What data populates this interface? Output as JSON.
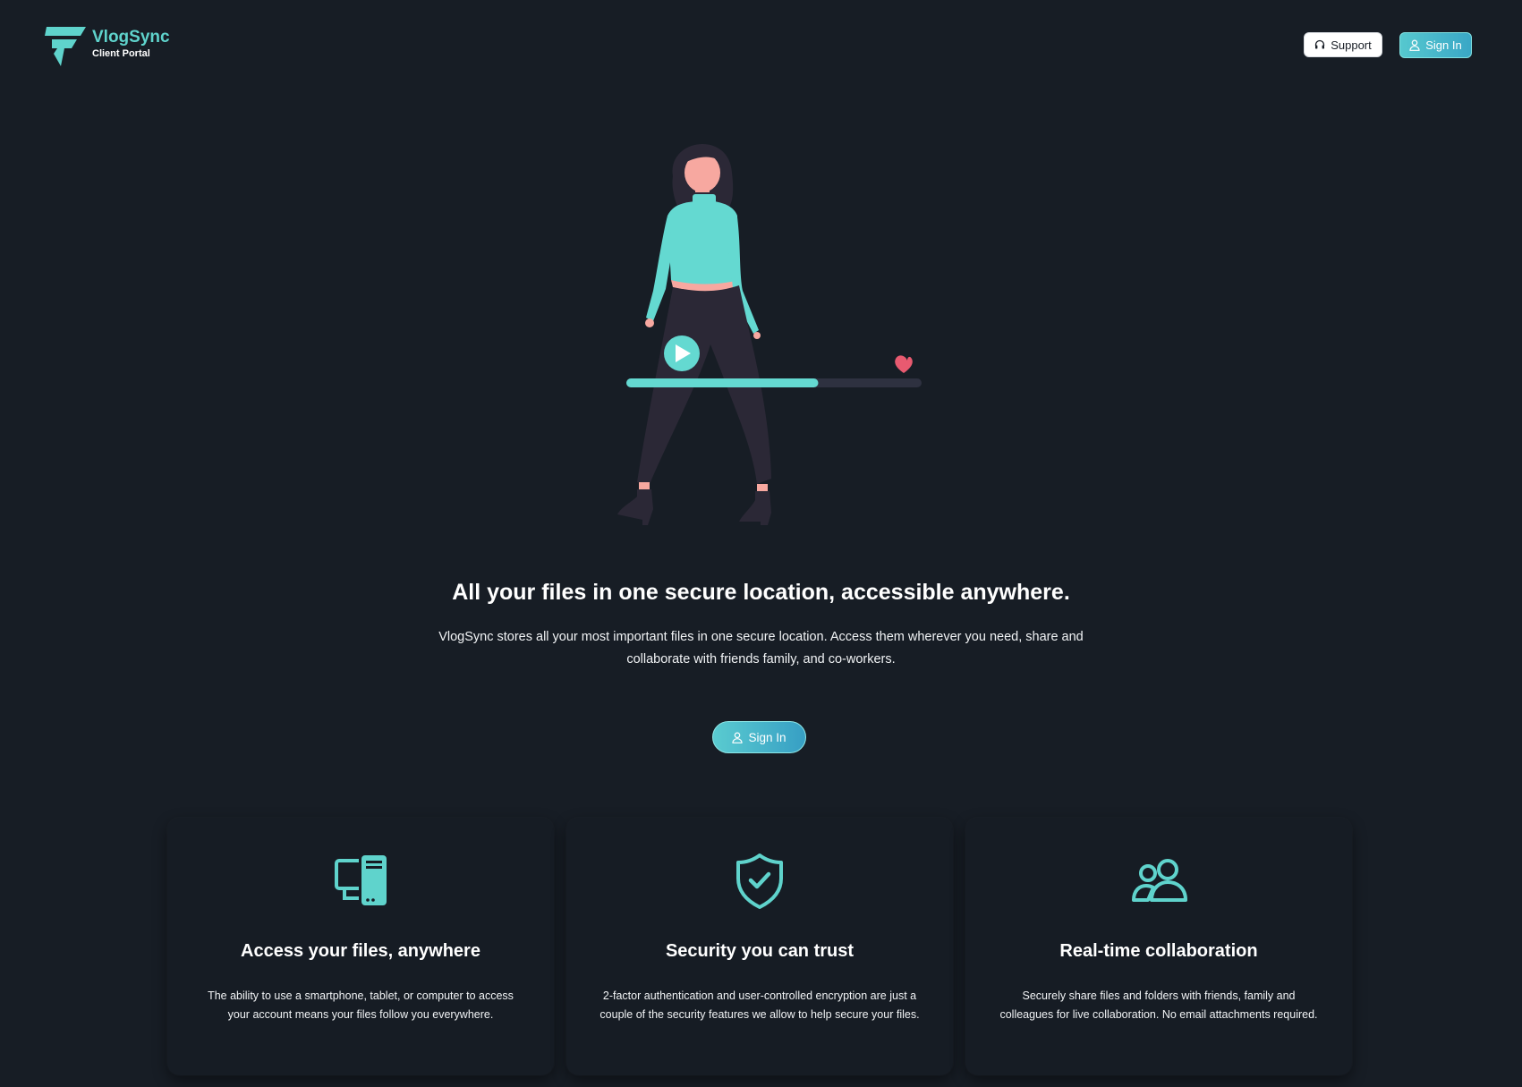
{
  "colors": {
    "background": "#171d25",
    "accent": "#5fd3cc",
    "card_background": "#161c24",
    "heart": "#e85a70",
    "progress_track": "#2e3140"
  },
  "header": {
    "brand_name": "VlogSync",
    "brand_subtitle": "Client Portal",
    "support_label": "Support",
    "support_icon": "headset-icon",
    "signin_label": "Sign In",
    "signin_icon": "user-icon"
  },
  "hero": {
    "illustration": "woman-with-video-progress-bar",
    "video_progress": 0.65,
    "title": "All your files in one secure location, accessible anywhere.",
    "description": "VlogSync stores all your most important files in one secure location. Access them wherever you need, share and collaborate with friends family, and co-workers.",
    "cta_label": "Sign In"
  },
  "features": [
    {
      "icon": "devices-icon",
      "title": "Access your files, anywhere",
      "description": "The ability to use a smartphone, tablet, or computer to access your account means your files follow you everywhere."
    },
    {
      "icon": "shield-check-icon",
      "title": "Security you can trust",
      "description": "2-factor authentication and user-controlled encryption are just a couple of the security features we allow to help secure your files."
    },
    {
      "icon": "users-icon",
      "title": "Real-time collaboration",
      "description": "Securely share files and folders with friends, family and colleagues for live collaboration. No email attachments required."
    }
  ]
}
